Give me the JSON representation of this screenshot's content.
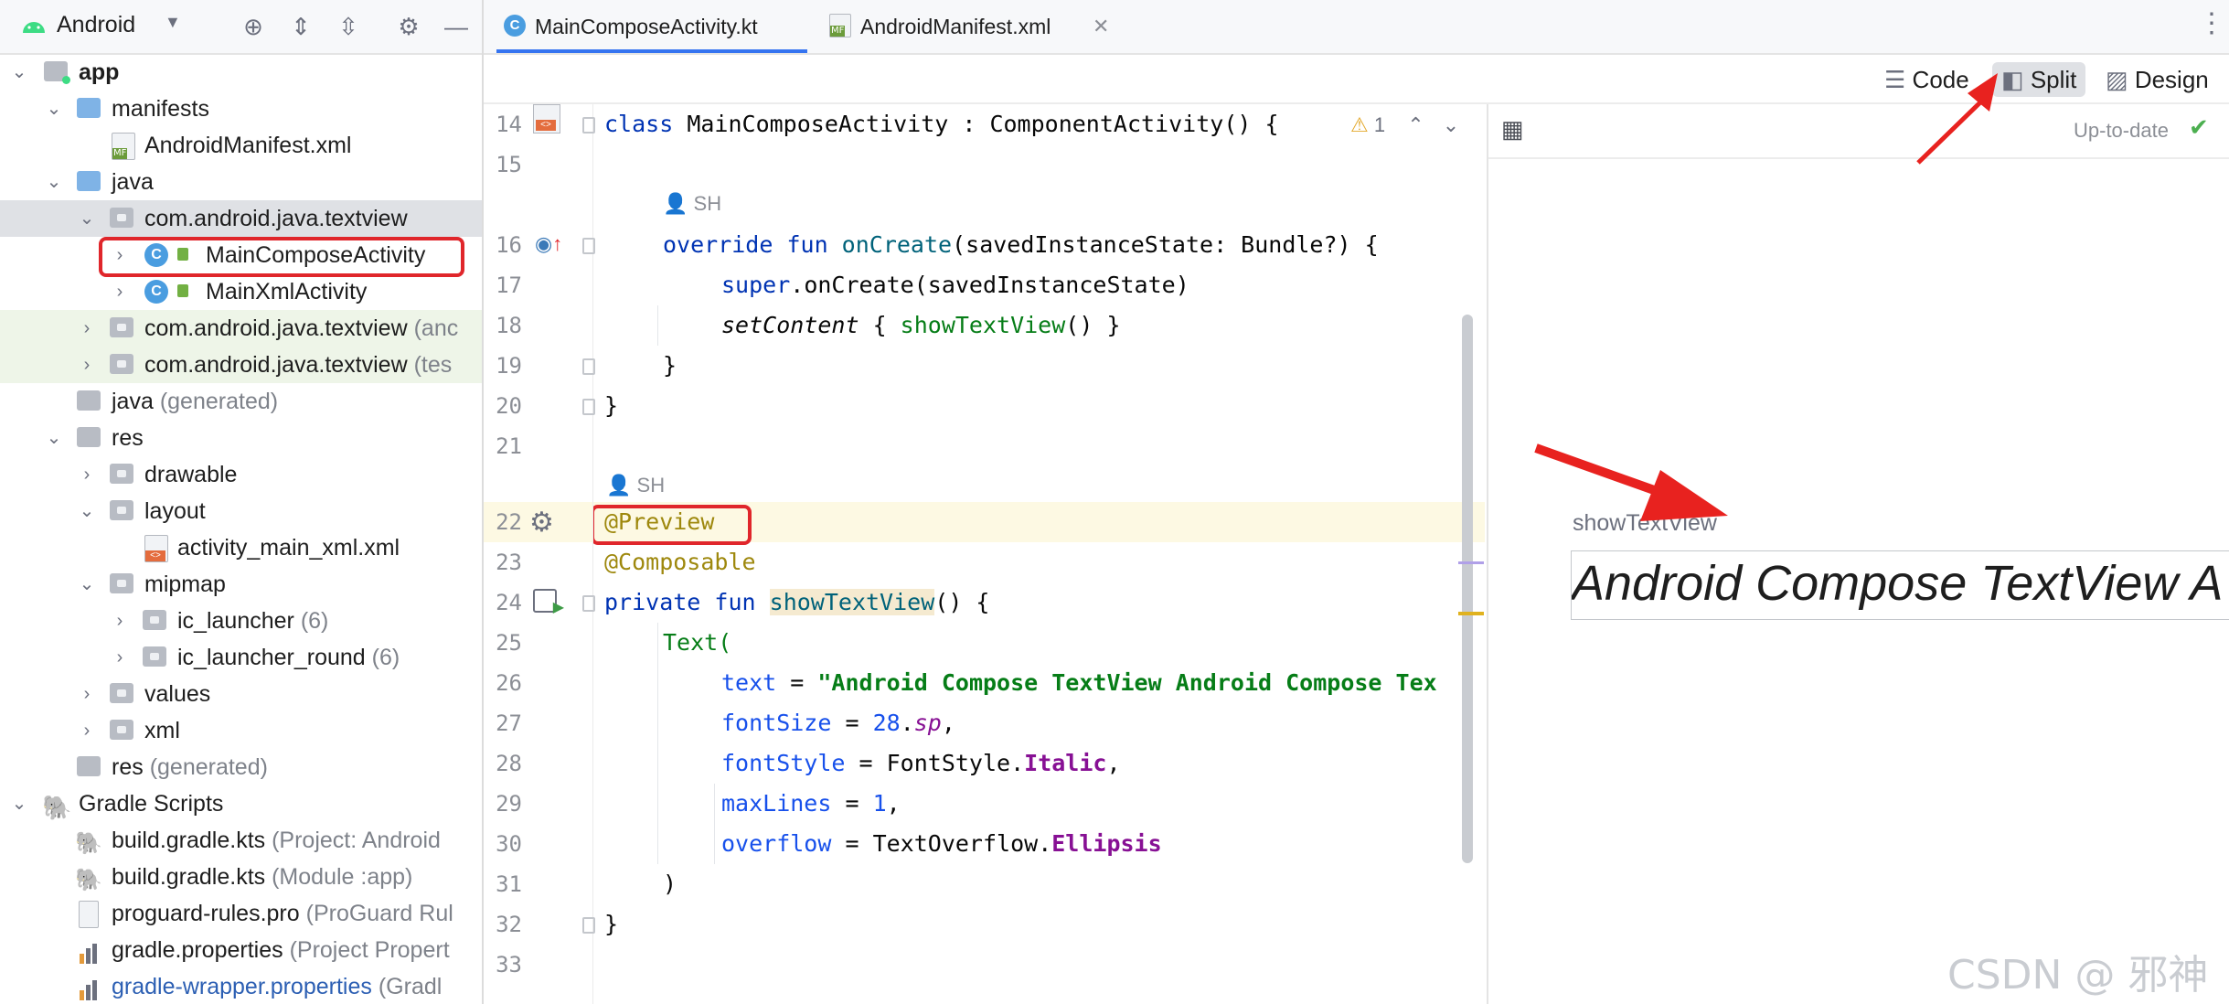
{
  "project_pane": {
    "view_selector": "Android",
    "tree": [
      {
        "label": "app",
        "bold": true
      },
      {
        "label": "manifests"
      },
      {
        "label": "AndroidManifest.xml"
      },
      {
        "label": "java"
      },
      {
        "label": "com.android.java.textview"
      },
      {
        "label": "MainComposeActivity"
      },
      {
        "label": "MainXmlActivity"
      },
      {
        "label": "com.android.java.textview",
        "suffix": "(anc"
      },
      {
        "label": "com.android.java.textview",
        "suffix": "(tes"
      },
      {
        "label": "java",
        "suffix": "(generated)"
      },
      {
        "label": "res"
      },
      {
        "label": "drawable"
      },
      {
        "label": "layout"
      },
      {
        "label": "activity_main_xml.xml"
      },
      {
        "label": "mipmap"
      },
      {
        "label": "ic_launcher",
        "suffix": "(6)"
      },
      {
        "label": "ic_launcher_round",
        "suffix": "(6)"
      },
      {
        "label": "values"
      },
      {
        "label": "xml"
      },
      {
        "label": "res",
        "suffix": "(generated)"
      },
      {
        "label": "Gradle Scripts"
      },
      {
        "label": "build.gradle.kts",
        "suffix": "(Project: Android"
      },
      {
        "label": "build.gradle.kts",
        "suffix": "(Module :app)"
      },
      {
        "label": "proguard-rules.pro",
        "suffix": "(ProGuard Rul"
      },
      {
        "label": "gradle.properties",
        "suffix": "(Project Propert"
      },
      {
        "label": "gradle-wrapper.properties",
        "suffix": "(Gradl"
      }
    ]
  },
  "editor": {
    "tabs": [
      {
        "label": "MainComposeActivity.kt",
        "active": true
      },
      {
        "label": "AndroidManifest.xml",
        "active": false
      }
    ],
    "modes": {
      "code": "Code",
      "split": "Split",
      "design": "Design"
    },
    "warning_count": "1",
    "author_hint": "SH",
    "line_numbers": [
      "14",
      "15",
      "16",
      "17",
      "18",
      "19",
      "20",
      "21",
      "22",
      "23",
      "24",
      "25",
      "26",
      "27",
      "28",
      "29",
      "30",
      "31",
      "32",
      "33"
    ]
  },
  "code": {
    "l14_class": "class",
    "l14_rest": " MainComposeActivity : ComponentActivity() {",
    "l16_override": "override fun",
    "l16_fn": " onCreate",
    "l16_rest": "(savedInstanceState: Bundle?) {",
    "l17_super": "super",
    "l17_rest": ".onCreate(savedInstanceState)",
    "l18_set": "setContent",
    "l18_mid": " { ",
    "l18_call": "showTextView",
    "l18_end": "() }",
    "l19": "}",
    "l20": "}",
    "l22": "@Preview",
    "l23": "@Composable",
    "l24_kw": "private fun",
    "l24_fn": "showTextView",
    "l24_rest": "() {",
    "l25": "Text(",
    "l26_param": "text",
    "l26_eq": " = ",
    "l26_str": "\"Android Compose TextView Android Compose Tex",
    "l27_param": "fontSize",
    "l27_eq": " = ",
    "l27_num": "28",
    "l27_dot": ".",
    "l27_sp": "sp",
    "l27_comma": ",",
    "l28_param": "fontStyle",
    "l28_eq": " = FontStyle.",
    "l28_enum": "Italic",
    "l28_comma": ",",
    "l29_param": "maxLines",
    "l29_eq": " = ",
    "l29_num": "1",
    "l29_comma": ",",
    "l30_param": "overflow",
    "l30_eq": " = TextOverflow.",
    "l30_enum": "Ellipsis",
    "l31": ")",
    "l32": "}"
  },
  "preview": {
    "status": "Up-to-date",
    "composable_name": "showTextView",
    "rendered_text": "Android Compose TextView A"
  },
  "watermark": "CSDN @ 邪神",
  "colors": {
    "accent": "#3574f0",
    "highlight_box": "#e0262b",
    "arrow": "#e8221f"
  }
}
